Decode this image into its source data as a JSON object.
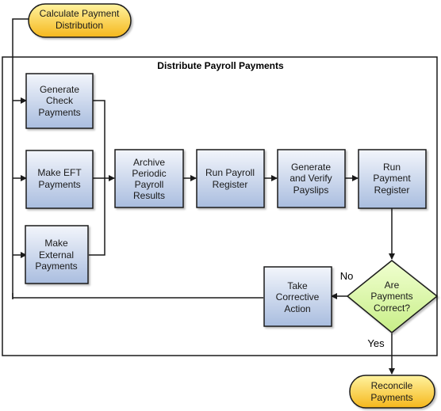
{
  "diagram": {
    "container": {
      "title": "Distribute Payroll Payments"
    },
    "nodes": {
      "calculate": {
        "type": "terminator",
        "lines": [
          "Calculate Payment",
          "Distribution"
        ]
      },
      "check": {
        "type": "process",
        "lines": [
          "Generate",
          "Check",
          "Payments"
        ]
      },
      "eft": {
        "type": "process",
        "lines": [
          "Make EFT",
          "Payments"
        ]
      },
      "external": {
        "type": "process",
        "lines": [
          "Make",
          "External",
          "Payments"
        ]
      },
      "archive": {
        "type": "process",
        "lines": [
          "Archive",
          "Periodic",
          "Payroll",
          "Results"
        ]
      },
      "run_payroll": {
        "type": "process",
        "lines": [
          "Run Payroll",
          "Register"
        ]
      },
      "payslips": {
        "type": "process",
        "lines": [
          "Generate",
          "and Verify",
          "Payslips"
        ]
      },
      "run_payment": {
        "type": "process",
        "lines": [
          "Run",
          "Payment",
          "Register"
        ]
      },
      "decision": {
        "type": "decision",
        "lines": [
          "Are",
          "Payments",
          "Correct?"
        ]
      },
      "corrective": {
        "type": "process",
        "lines": [
          "Take",
          "Corrective",
          "Action"
        ]
      },
      "reconcile": {
        "type": "terminator",
        "lines": [
          "Reconcile",
          "Payments"
        ]
      }
    },
    "edge_labels": {
      "no": "No",
      "yes": "Yes"
    },
    "colors": {
      "process_top": "#f2f5fb",
      "process_bottom": "#a9bddf",
      "terminator_top": "#fff3a0",
      "terminator_bottom": "#f5b71c",
      "decision_fill": "#d9f5a0",
      "stroke": "#1a1a1a"
    }
  }
}
